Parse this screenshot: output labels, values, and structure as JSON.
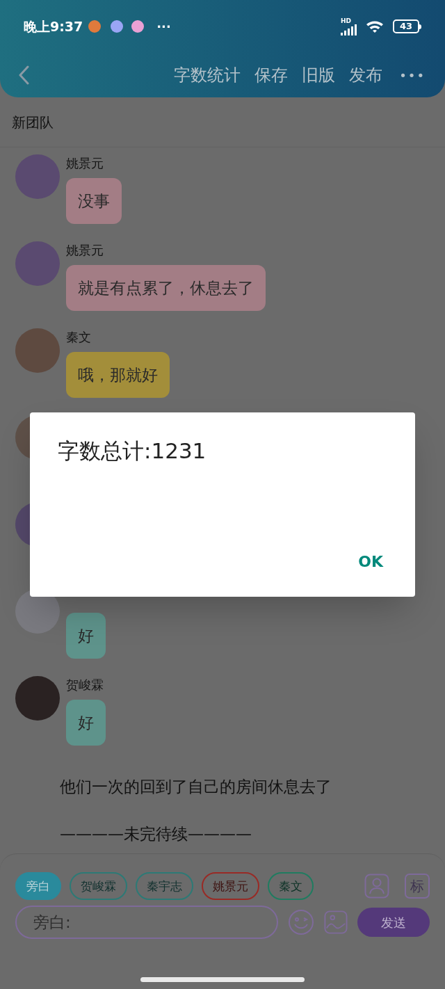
{
  "status_bar": {
    "time": "晚上9:37",
    "notification_dots": "···",
    "network": "HD",
    "battery": "43"
  },
  "header": {
    "actions": [
      "字数统计",
      "保存",
      "旧版",
      "发布"
    ],
    "more": "•••"
  },
  "chat_title": "新团队",
  "messages": [
    {
      "kind": "chat",
      "name": "姚景元",
      "text": "没事",
      "color": "#a37d85"
    },
    {
      "kind": "chat",
      "name": "姚景元",
      "text": "就是有点累了，休息去了",
      "color": "#a37d85"
    },
    {
      "kind": "chat",
      "name": "秦文",
      "text": "哦，那就好",
      "color": "#a38e3a"
    },
    {
      "kind": "hidden"
    },
    {
      "kind": "hidden"
    },
    {
      "kind": "chat",
      "text": "好",
      "color": "#5e938b"
    },
    {
      "kind": "chat",
      "name": "贺峻霖",
      "text": "好",
      "color": "#5e938b"
    },
    {
      "kind": "narration",
      "text": "他们一次的回到了自己的房间休息去了"
    },
    {
      "kind": "narration",
      "text": "————未完待续————"
    }
  ],
  "roles": [
    {
      "label": "旁白",
      "selected": true,
      "color": "#2a8a9c"
    },
    {
      "label": "贺峻霖",
      "selected": false,
      "color": "#2c7a76"
    },
    {
      "label": "秦宇志",
      "selected": false,
      "color": "#2c7a76"
    },
    {
      "label": "姚景元",
      "selected": false,
      "color": "#992a25"
    },
    {
      "label": "秦文",
      "selected": false,
      "color": "#1f7c60"
    }
  ],
  "mark_button": "标",
  "input": {
    "placeholder": "旁白:"
  },
  "send_button": "发送",
  "dialog": {
    "message": "字数总计:1231",
    "button": "OK"
  }
}
